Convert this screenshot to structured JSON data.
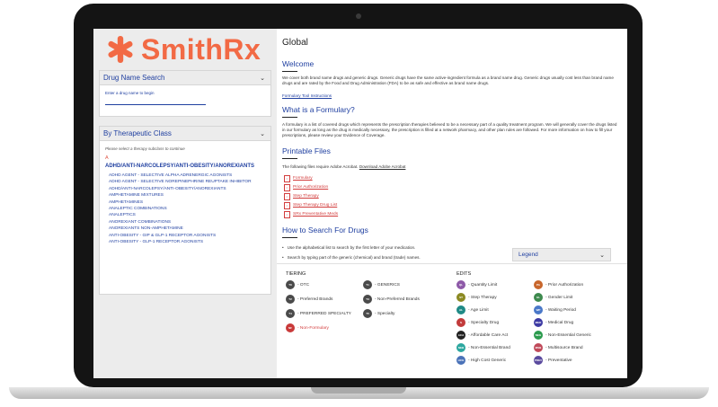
{
  "brand": {
    "name": "SmithRx",
    "color": "#f26a45"
  },
  "sidebar": {
    "drug_search": {
      "title": "Drug Name Search",
      "hint": "Enter a drug name to begin"
    },
    "therapeutic": {
      "title": "By Therapeutic Class",
      "instruction": "Please select a therapy subclass to continue",
      "letter": "A",
      "class_title": "ADHD/ANTI-NARCOLEPSY/ANTI-OBESITY/ANOREXIANTS",
      "items": [
        "ADHD AGENT - SELECTIVE ALPHA ADRENERGIC AGONISTS",
        "ADHD AGENT - SELECTIVE NOREPINEPHRINE REUPTAKE INHIBITOR",
        "ADHD/ANTI-NARCOLEPSY/ANTI-OBESITY/ANOREXIANTS",
        "AMPHETAMINE MIXTURES",
        "AMPHETAMINES",
        "ANALEPTIC COMBINATIONS",
        "ANALEPTICS",
        "ANOREXIANT COMBINATIONS",
        "ANOREXIANTS NON-AMPHETAMINE",
        "ANTI-OBESITY - GIP & GLP-1 RECEPTOR AGONISTS",
        "ANTI-OBESITY - GLP-1 RECEPTOR AGONISTS"
      ]
    }
  },
  "main": {
    "title": "Global",
    "welcome": {
      "heading": "Welcome",
      "text": "We cover both brand name drugs and generic drugs. Generic drugs have the same active-ingredient formula as a brand name drug. Generic drugs usually cost less than brand name drugs and are rated by the Food and Drug Administration (FDA) to be as safe and effective as brand name drugs.",
      "link": "Formulary Tool Instructions"
    },
    "formulary": {
      "heading": "What is a Formulary?",
      "text": "A formulary is a list of covered drugs which represents the prescription therapies believed to be a necessary part of a quality treatment program. We will generally cover the drugs listed in our formulary as long as the drug is medically necessary, the prescription is filled at a network pharmacy, and other plan rules are followed. For more information on how to fill your prescriptions, please review your Evidence of Coverage."
    },
    "printable": {
      "heading": "Printable Files",
      "intro": "The following files require Adobe Acrobat.",
      "download": "Download Adobe Acrobat",
      "files": [
        "Formulary",
        "Prior Authorization",
        "Step Therapy",
        "Step Therapy Drug List",
        "SRx Preventative Meds"
      ]
    },
    "howto": {
      "heading": "How to Search For Drugs",
      "bullets": [
        "Use the alphabetical list to search by the first letter of your medication.",
        "Search by typing part of the generic (chemical) and brand (trade) names."
      ]
    }
  },
  "legend": {
    "title": "Legend",
    "tiering_label": "TIERING",
    "edits_label": "EDITS",
    "tiering": [
      {
        "code": "T0",
        "label": "- OTC",
        "color": "#4a4a4a"
      },
      {
        "code": "T1",
        "label": "- GENERICS",
        "color": "#4a4a4a"
      },
      {
        "code": "T2",
        "label": "- Preferred Brands",
        "color": "#4a4a4a"
      },
      {
        "code": "T3",
        "label": "- Non-Preferred Brands",
        "color": "#4a4a4a"
      },
      {
        "code": "T4",
        "label": "- PREFERRED SPECIALTY",
        "color": "#4a4a4a"
      },
      {
        "code": "T5",
        "label": "- Specialty",
        "color": "#4a4a4a"
      },
      {
        "code": "NF",
        "label": "- Non-Formulary",
        "color": "#c93a3a"
      }
    ],
    "edits": [
      {
        "code": "QL",
        "label": "- Quantity Limit",
        "color": "#8e5aa8"
      },
      {
        "code": "PA",
        "label": "- Prior Authorization",
        "color": "#c8662c"
      },
      {
        "code": "ST",
        "label": "- Step Therapy",
        "color": "#8c8a23"
      },
      {
        "code": "GL",
        "label": "- Gender Limit",
        "color": "#3e8a4e"
      },
      {
        "code": "AL",
        "label": "- Age Limit",
        "color": "#1f8a86"
      },
      {
        "code": "WP",
        "label": "- Waiting Period",
        "color": "#4a78c8"
      },
      {
        "code": "S",
        "label": "- Specialty Drug",
        "color": "#c23b3b"
      },
      {
        "code": "MED",
        "label": "- Medical Drug",
        "color": "#3d3aa3"
      },
      {
        "code": "ACA",
        "label": "- Affordable Care Act",
        "color": "#222222"
      },
      {
        "code": "NEG",
        "label": "- Non-Essential Generic",
        "color": "#2c9b4e"
      },
      {
        "code": "NEB",
        "label": "- Non-Essential Brand",
        "color": "#2ea8a0"
      },
      {
        "code": "MSB",
        "label": "- Multisource Brand",
        "color": "#c04a5a"
      },
      {
        "code": "HCG",
        "label": "- High Cost Generic",
        "color": "#4a72b8"
      },
      {
        "code": "PREV",
        "label": "- Preventative",
        "color": "#5a4a9e"
      }
    ]
  }
}
